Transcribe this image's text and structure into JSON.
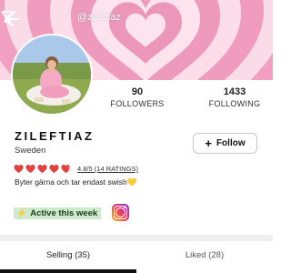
{
  "header": {
    "handle": "@zileftiaz",
    "icons": [
      "back-arrow-icon",
      "filter-icon",
      "more-vertical-icon"
    ]
  },
  "profile": {
    "name": "ZILEFTIAZ",
    "location": "Sweden",
    "bio": "Byter gärna och tar endast swish💛",
    "rating_text": "4.8/5 (14 RATINGS)",
    "rating": 4.8,
    "rating_max": 5
  },
  "stats": {
    "followers_count": "90",
    "followers_label": "FOLLOWERS",
    "following_count": "1433",
    "following_label": "FOLLOWING"
  },
  "actions": {
    "follow_label": "Follow"
  },
  "badges": {
    "active_label": "Active this week",
    "instagram_icon": "instagram-icon"
  },
  "tabs": [
    {
      "label": "Selling (35)",
      "selected": true
    },
    {
      "label": "Liked (28)",
      "selected": false
    }
  ],
  "colors": {
    "banner_pink": "#f6b9d2",
    "heart_red": "#e0433f",
    "active_green_bg": "#cfe9cc"
  }
}
